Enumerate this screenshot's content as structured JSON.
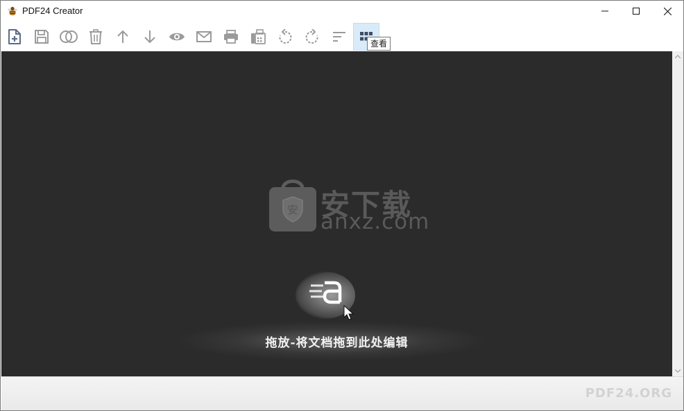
{
  "window": {
    "title": "PDF24 Creator",
    "icon": "pdf24-bee-icon"
  },
  "toolbar": {
    "buttons": [
      {
        "name": "add-file-button",
        "icon": "file-plus-icon"
      },
      {
        "name": "save-button",
        "icon": "floppy-disk-icon"
      },
      {
        "name": "merge-button",
        "icon": "overlap-circles-icon"
      },
      {
        "name": "delete-button",
        "icon": "trash-icon"
      },
      {
        "name": "move-up-button",
        "icon": "arrow-up-icon"
      },
      {
        "name": "move-down-button",
        "icon": "arrow-down-icon"
      },
      {
        "name": "preview-button",
        "icon": "eye-icon"
      },
      {
        "name": "email-button",
        "icon": "envelope-icon"
      },
      {
        "name": "print-button",
        "icon": "printer-icon"
      },
      {
        "name": "fax-button",
        "icon": "fax-icon"
      },
      {
        "name": "rotate-left-button",
        "icon": "rotate-left-icon"
      },
      {
        "name": "rotate-right-button",
        "icon": "rotate-right-icon"
      },
      {
        "name": "sort-button",
        "icon": "sort-icon"
      },
      {
        "name": "view-button",
        "icon": "grid-view-icon",
        "active": true
      }
    ],
    "tooltip": "查看",
    "menu_icon": "hamburger-menu-icon"
  },
  "workspace": {
    "watermark_cn": "安下载",
    "watermark_en": "anxz.com",
    "drop_hint": "拖放-将文档拖到此处编辑"
  },
  "footer": {
    "brand": "PDF24.ORG"
  },
  "colors": {
    "workspace_bg": "#2b2b2b",
    "icon_gray": "#8c8c8c",
    "icon_accent": "#5b6b86",
    "active_bg": "#d9ebf8"
  }
}
